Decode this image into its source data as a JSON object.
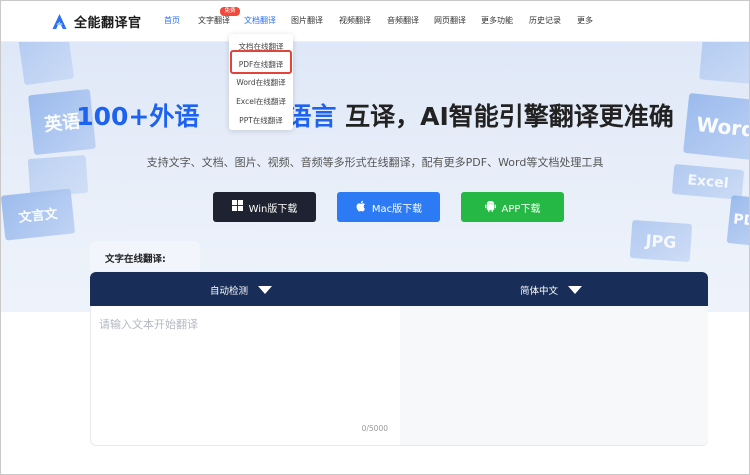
{
  "brand": {
    "name": "全能翻译官",
    "accent": "#2d6ff5"
  },
  "nav": {
    "items": [
      {
        "label": "首页"
      },
      {
        "label": "文字翻译"
      },
      {
        "label": "文档翻译"
      },
      {
        "label": "图片翻译"
      },
      {
        "label": "视频翻译"
      },
      {
        "label": "音频翻译"
      },
      {
        "label": "网页翻译"
      },
      {
        "label": "更多功能"
      },
      {
        "label": "历史记录"
      },
      {
        "label": "更多"
      }
    ],
    "badge": "免费"
  },
  "dropdown": {
    "items": [
      {
        "label": "文档在线翻译"
      },
      {
        "label": "PDF在线翻译"
      },
      {
        "label": "Word在线翻译"
      },
      {
        "label": "Excel在线翻译"
      },
      {
        "label": "PPT在线翻译"
      }
    ]
  },
  "hero": {
    "title_part1": "100+外语",
    "title_part2": "族语言",
    "title_part3": "互译，AI智能引擎翻译更准确",
    "subtitle": "支持文字、文档、图片、视频、音频等多形式在线翻译，配有更多PDF、Word等文档处理工具",
    "deco": [
      "英语",
      "文言文",
      "Word",
      "Excel",
      "JPG",
      "PDF"
    ]
  },
  "downloads": {
    "win": "Win版下载",
    "mac": "Mac版下载",
    "app": "APP下载"
  },
  "translator": {
    "tab_label": "文字在线翻译:",
    "source_lang": "自动检测",
    "target_lang": "简体中文",
    "placeholder": "请输入文本开始翻译",
    "counter": "0/5000"
  }
}
